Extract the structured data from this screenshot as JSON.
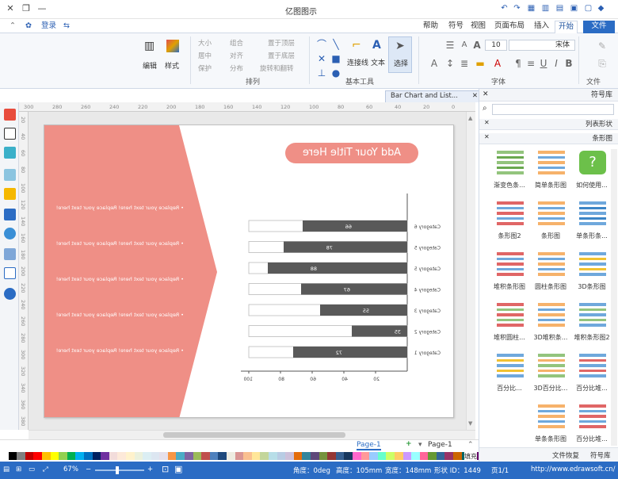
{
  "app": {
    "title": "亿图图示"
  },
  "quick_access": [
    "save-icon",
    "undo-icon",
    "redo-icon",
    "print-icon",
    "export-icon",
    "share-icon"
  ],
  "login_label": "登录",
  "tabs": [
    {
      "label": "文件"
    },
    {
      "label": "开始"
    },
    {
      "label": "插入"
    },
    {
      "label": "页面布局"
    },
    {
      "label": "视图"
    },
    {
      "label": "符号"
    },
    {
      "label": "帮助"
    }
  ],
  "ribbon": {
    "groups": {
      "file": "文件",
      "font": "字体",
      "basic_tools": "基本工具",
      "arrange": "排列",
      "style": "样式",
      "edit": "编辑"
    },
    "font_name": "宋体",
    "font_size": "10",
    "select_label": "选择",
    "text_label": "文本",
    "connector_label": "连接线",
    "style_label": "样式",
    "edit_label": "编辑",
    "arrange_items": [
      "置于顶层",
      "置于底层",
      "旋转和翻转",
      "组合",
      "对齐",
      "分布",
      "大小",
      "居中",
      "保护"
    ]
  },
  "document_tab": {
    "label": "Bar Chart and List..."
  },
  "ruler": {
    "h_ticks": [
      "300",
      "280",
      "260",
      "240",
      "220",
      "200",
      "180",
      "160",
      "140",
      "120",
      "100",
      "80",
      "60",
      "40",
      "20",
      "0"
    ],
    "v_ticks": [
      "20",
      "40",
      "60",
      "80",
      "100",
      "120",
      "140",
      "160",
      "180",
      "200",
      "220",
      "240",
      "260",
      "280",
      "300",
      "320",
      "340",
      "360",
      "380"
    ]
  },
  "slide": {
    "title": "Add Your Title Here",
    "bullets": [
      "Replace your text here!  Replace your text here!",
      "Replace your text here!  Replace your text here!",
      "Replace your text here!  Replace your text here!",
      "Replace your text here!  Replace your text here!",
      "Replace your text here!  Replace your text here!"
    ],
    "colors": {
      "accent": "#ef8f86",
      "bar": "#595959",
      "track": "#ffffff"
    }
  },
  "chart_data": {
    "type": "bar",
    "orientation": "horizontal",
    "categories": [
      "Category 1",
      "Category 2",
      "Category 3",
      "Category 4",
      "Category 5",
      "Category 5",
      "Category 6"
    ],
    "values": [
      72,
      35,
      55,
      67,
      88,
      78,
      66
    ],
    "xlim": [
      0,
      100
    ],
    "x_ticks": [
      "20",
      "40",
      "60",
      "80",
      "100"
    ],
    "grid": false,
    "legend": "none"
  },
  "page_nav": {
    "page_label": "Page-1",
    "tab_label": "Page-1"
  },
  "status": {
    "website": "http://www.edrawsoft.cn/",
    "page": "页1/1",
    "shape_id": "形状 ID：1449",
    "width": "宽度：148mm",
    "height": "高度：105mm",
    "angle": "角度：0deg",
    "zoom": "67%"
  },
  "right_panel": {
    "title": "符号库",
    "sections": [
      "列表形状",
      "条形图"
    ],
    "symbols": [
      {
        "label": "如何使用..."
      },
      {
        "label": "简单条形图"
      },
      {
        "label": "渐变色条..."
      },
      {
        "label": "单条形条..."
      },
      {
        "label": "条形图"
      },
      {
        "label": "条形图2"
      },
      {
        "label": "3D条形图"
      },
      {
        "label": "圆柱条形图"
      },
      {
        "label": "堆积条形图"
      },
      {
        "label": "堆积条形图2"
      },
      {
        "label": "3D堆积条..."
      },
      {
        "label": "堆积圆柱..."
      },
      {
        "label": "百分比堆..."
      },
      {
        "label": "3D百分比..."
      },
      {
        "label": "百分比..."
      },
      {
        "label": "百分比堆..."
      },
      {
        "label": "单条条形图"
      }
    ],
    "bottom_tabs": [
      "符号库",
      "文件恢复"
    ]
  },
  "fill_label": "填充"
}
